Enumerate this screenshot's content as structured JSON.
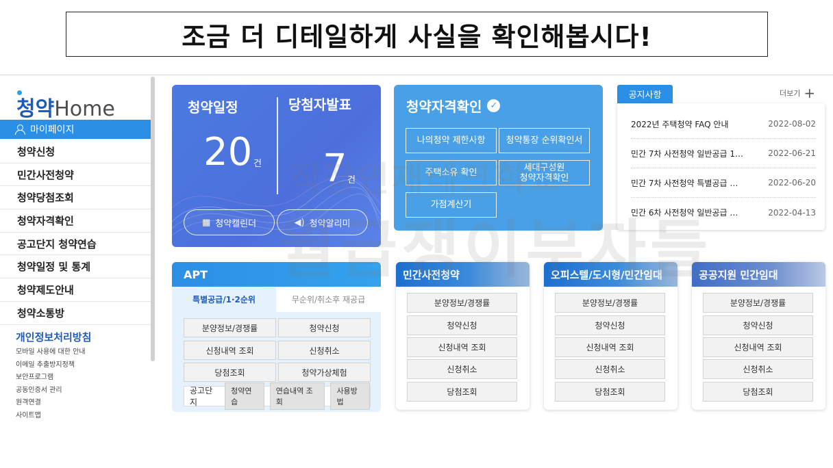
{
  "caption": "조금 더 디테일하게 사실을 확인해봅시다!",
  "sidebar": {
    "logo_a": "청약",
    "logo_b": "Home",
    "mypage": "마이페이지",
    "items": [
      "청약신청",
      "민간사전청약",
      "청약당첨조회",
      "청약자격확인",
      "공고단지 청약연습",
      "청약일정 및 통계",
      "청약제도안내",
      "청약소통방"
    ],
    "privacy": "개인정보처리방침",
    "sublinks": [
      "모바일 사용에 대한 안내",
      "이메일 추출방지정책",
      "보안프로그램",
      "공동인증서 관리",
      "원격연결",
      "사이트맵"
    ]
  },
  "schedule": {
    "label": "청약일정",
    "count": "20",
    "unit": "건",
    "win_label": "당첨자발표",
    "win_count": "7",
    "win_unit": "건",
    "calendar_btn": "청약캘린더",
    "alarm_btn": "청약알리미"
  },
  "qualification": {
    "title": "청약자격확인",
    "buttons": [
      "나의청약 제한사항",
      "청약통장 순위확인서",
      "주택소유 확인",
      "세대구성원\n청약자격확인",
      "가점계산기"
    ]
  },
  "notice": {
    "tab": "공지사항",
    "more": "더보기",
    "rows": [
      {
        "title": "2022년 주택청약 FAQ 안내",
        "date": "2022-08-02"
      },
      {
        "title": "민간 7차 사전청약 일반공급 1…",
        "date": "2022-06-21"
      },
      {
        "title": "민간 7차 사전청약 특별공급 …",
        "date": "2022-06-20"
      },
      {
        "title": "민간 6차 사전청약 일반공급 …",
        "date": "2022-04-13"
      }
    ]
  },
  "apt": {
    "title": "APT",
    "tab_active": "특별공급/1·2순위",
    "tab_inactive": "무순위/취소후 재공급",
    "buttons": [
      "분양정보/경쟁률",
      "청약신청",
      "신청내역 조회",
      "신청취소",
      "당첨조회",
      "청약가상체험"
    ],
    "footer_label": "공고단지",
    "footer_chips": [
      "청약연습",
      "연습내역 조회",
      "사용방법"
    ]
  },
  "panels": [
    {
      "title": "민간사전청약",
      "buttons": [
        "분양정보/경쟁률",
        "청약신청",
        "신청내역 조회",
        "신청취소",
        "당첨조회"
      ]
    },
    {
      "title": "오피스텔/도시형/민간임대",
      "buttons": [
        "분양정보/경쟁률",
        "청약신청",
        "신청내역 조회",
        "신청취소",
        "당첨조회"
      ]
    },
    {
      "title": "공공지원 민간임대",
      "buttons": [
        "분양정보/경쟁률",
        "청약신청",
        "신청내역 조회",
        "신청취소",
        "당첨조회"
      ]
    }
  ],
  "watermark": {
    "line1": "직장인재테크학교",
    "line2": "월급쟁이부자들"
  },
  "colors": {
    "primary": "#2b8fe6",
    "schedule_card": "#4d6fdc",
    "qual_card": "#4aa0e6",
    "brand_text": "#1e5bb8"
  }
}
